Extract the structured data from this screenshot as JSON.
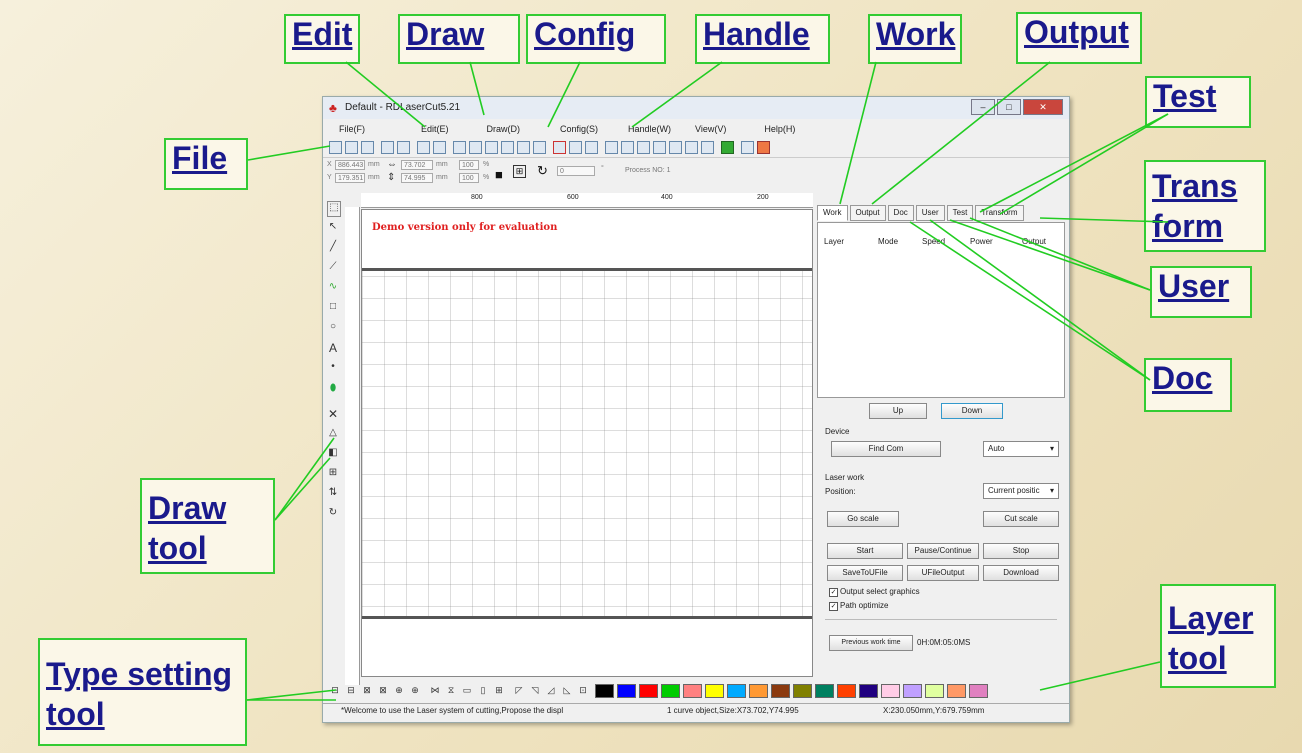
{
  "callouts": {
    "edit": "Edit",
    "draw": "Draw",
    "config": "Config",
    "handle": "Handle",
    "work": "Work",
    "output": "Output",
    "test": "Test",
    "file": "File",
    "transform": "Trans form",
    "user": "User",
    "doc": "Doc",
    "draw_tool": "Draw tool",
    "layer_tool": "Layer tool",
    "type_setting_tool": "Type setting tool"
  },
  "window": {
    "title": "Default - RDLaserCut5.21",
    "minimize": "–",
    "maximize": "□",
    "close": "✕"
  },
  "menu": [
    "File(F)",
    "Edit(E)",
    "Draw(D)",
    "Config(S)",
    "Handle(W)",
    "View(V)",
    "Help(H)"
  ],
  "coords": {
    "x_label": "X",
    "y_label": "Y",
    "x_value": "886.443",
    "y_value": "179.351",
    "unit": "mm",
    "w_value": "73.702",
    "h_value": "74.995",
    "pct_w": "100",
    "pct_h": "100",
    "pct": "%",
    "angle": "0",
    "degree": "°",
    "process_no": "Process NO: 1"
  },
  "ruler": {
    "marks": [
      "800",
      "600",
      "400",
      "200"
    ]
  },
  "canvas": {
    "demo_text": "Demo version only for evaluation"
  },
  "tabs": [
    "Work",
    "Output",
    "Doc",
    "User",
    "Test",
    "Transform"
  ],
  "layer_table": {
    "headers": [
      "Layer",
      "Mode",
      "Speed",
      "Power",
      "Output"
    ]
  },
  "work_panel": {
    "up": "Up",
    "down": "Down",
    "device_label": "Device",
    "find_com": "Find Com",
    "auto": "Auto",
    "laser_work": "Laser work",
    "position": "Position:",
    "position_value": "Current positic",
    "go_scale": "Go scale",
    "cut_scale": "Cut scale",
    "start": "Start",
    "pause": "Pause/Continue",
    "stop": "Stop",
    "save_ufile": "SaveToUFile",
    "ufile_output": "UFileOutput",
    "download": "Download",
    "output_select": "Output select graphics",
    "path_optimize": "Path optimize",
    "prev_work_time": "Previous work time",
    "time_value": "0H:0M:05:0MS"
  },
  "status": {
    "message": "*Welcome to use the Laser system of cutting,Propose the displ",
    "object_info": "1 curve object,Size:X73.702,Y74.995",
    "pointer": "X:230.050mm,Y:679.759mm"
  },
  "colors": {
    "callout_border": "#33cc33",
    "callout_text": "#1a1a8c",
    "demo_text": "#e02020",
    "layer_swatches": [
      "#000000",
      "#0000ff",
      "#ff0000",
      "#00cc00",
      "#ff8080",
      "#ffff00",
      "#00aaff",
      "#ff9933",
      "#8b3a0f",
      "#808000",
      "#008060",
      "#ff4000",
      "#200080",
      "#ffcce6",
      "#c0a0ff",
      "#e0ffa0",
      "#ff9966",
      "#e080c0"
    ]
  }
}
